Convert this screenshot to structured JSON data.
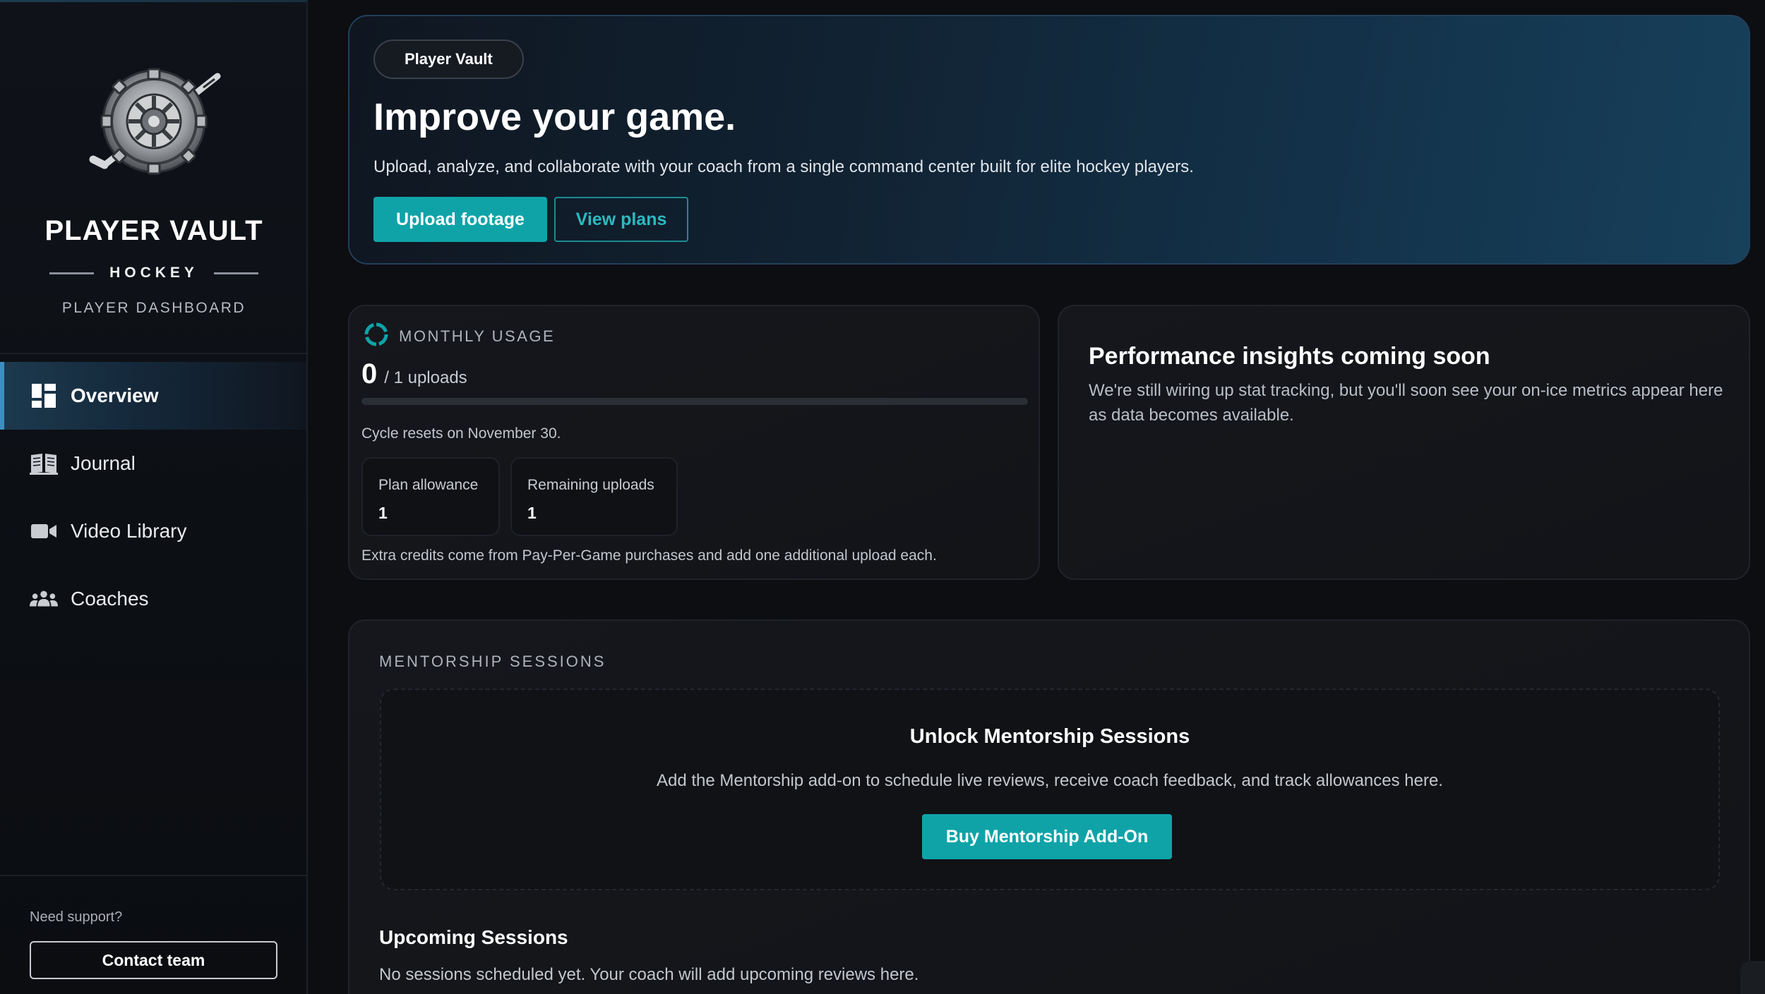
{
  "sidebar": {
    "brand_title": "PLAYER VAULT",
    "brand_subtitle": "HOCKEY",
    "brand_role": "PLAYER DASHBOARD",
    "items": [
      {
        "label": "Overview",
        "icon": "dashboard-icon",
        "active": true
      },
      {
        "label": "Journal",
        "icon": "book-icon",
        "active": false
      },
      {
        "label": "Video Library",
        "icon": "video-camera-icon",
        "active": false
      },
      {
        "label": "Coaches",
        "icon": "group-icon",
        "active": false
      }
    ],
    "support_label": "Need support?",
    "contact_label": "Contact team"
  },
  "hero": {
    "pill": "Player Vault",
    "title": "Improve your game.",
    "description": "Upload, analyze, and collaborate with your coach from a single command center built for elite hockey players.",
    "primary_label": "Upload footage",
    "secondary_label": "View plans"
  },
  "usage": {
    "label": "MONTHLY USAGE",
    "count": "0",
    "of_text": "/ 1 uploads",
    "progress": 0,
    "cycle_text": "Cycle resets on November 30.",
    "stats": [
      {
        "label": "Plan allowance",
        "value": "1"
      },
      {
        "label": "Remaining uploads",
        "value": "1"
      }
    ],
    "extra_text": "Extra credits come from Pay-Per-Game purchases and add one additional upload each."
  },
  "insights": {
    "title": "Performance insights coming soon",
    "text": "We're still wiring up stat tracking, but you'll soon see your on-ice metrics appear here as data becomes available."
  },
  "mentorship": {
    "label": "MENTORSHIP SESSIONS",
    "unlock_title": "Unlock Mentorship Sessions",
    "unlock_text": "Add the Mentorship add-on to schedule live reviews, receive coach feedback, and track allowances here.",
    "unlock_button": "Buy Mentorship Add-On",
    "upcoming_title": "Upcoming Sessions",
    "upcoming_text": "No sessions scheduled yet. Your coach will add upcoming reviews here."
  },
  "colors": {
    "accent": "#0fa3a8",
    "active_nav": "#3c8fc0",
    "background": "#0d0e12"
  }
}
